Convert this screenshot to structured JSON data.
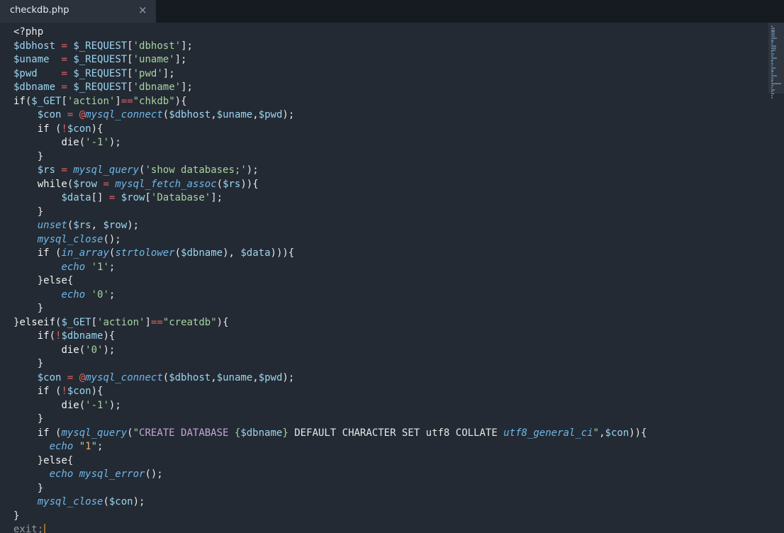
{
  "tab": {
    "title": "checkdb.php",
    "close_glyph": "×",
    "close_icon": "close-icon"
  },
  "colors": {
    "variable": "#9cd5f0",
    "operator": "#e5605f",
    "string": "#a8d3a0",
    "function": "#6fb7e9",
    "number": "#f2b36a",
    "sql": "#c6a6d9",
    "caret": "#f5a623",
    "background": "#232a33"
  },
  "code": {
    "lines": [
      [
        [
          "plain",
          "<?php"
        ]
      ],
      [
        [
          "var",
          "$dbhost"
        ],
        [
          "plain",
          " "
        ],
        [
          "op",
          "="
        ],
        [
          "plain",
          " "
        ],
        [
          "var",
          "$_REQUEST"
        ],
        [
          "plain",
          "["
        ],
        [
          "str",
          "'dbhost'"
        ],
        [
          "plain",
          "];"
        ]
      ],
      [
        [
          "var",
          "$uname"
        ],
        [
          "plain",
          "  "
        ],
        [
          "op",
          "="
        ],
        [
          "plain",
          " "
        ],
        [
          "var",
          "$_REQUEST"
        ],
        [
          "plain",
          "["
        ],
        [
          "str",
          "'uname'"
        ],
        [
          "plain",
          "];"
        ]
      ],
      [
        [
          "var",
          "$pwd"
        ],
        [
          "plain",
          "    "
        ],
        [
          "op",
          "="
        ],
        [
          "plain",
          " "
        ],
        [
          "var",
          "$_REQUEST"
        ],
        [
          "plain",
          "["
        ],
        [
          "str",
          "'pwd'"
        ],
        [
          "plain",
          "];"
        ]
      ],
      [
        [
          "var",
          "$dbname"
        ],
        [
          "plain",
          " "
        ],
        [
          "op",
          "="
        ],
        [
          "plain",
          " "
        ],
        [
          "var",
          "$_REQUEST"
        ],
        [
          "plain",
          "["
        ],
        [
          "str",
          "'dbname'"
        ],
        [
          "plain",
          "];"
        ]
      ],
      [
        [
          "kw",
          "if"
        ],
        [
          "plain",
          "("
        ],
        [
          "var",
          "$_GET"
        ],
        [
          "plain",
          "["
        ],
        [
          "str",
          "'action'"
        ],
        [
          "plain",
          "]"
        ],
        [
          "op",
          "=="
        ],
        [
          "str",
          "\"chkdb\""
        ],
        [
          "plain",
          "){"
        ]
      ],
      [
        [
          "plain",
          "    "
        ],
        [
          "var",
          "$con"
        ],
        [
          "plain",
          " "
        ],
        [
          "op",
          "="
        ],
        [
          "plain",
          " "
        ],
        [
          "at",
          "@"
        ],
        [
          "fn",
          "mysql_connect"
        ],
        [
          "plain",
          "("
        ],
        [
          "var",
          "$dbhost"
        ],
        [
          "plain",
          ","
        ],
        [
          "var",
          "$uname"
        ],
        [
          "plain",
          ","
        ],
        [
          "var",
          "$pwd"
        ],
        [
          "plain",
          ");"
        ]
      ],
      [
        [
          "plain",
          "    "
        ],
        [
          "kw",
          "if"
        ],
        [
          "plain",
          " ("
        ],
        [
          "op",
          "!"
        ],
        [
          "var",
          "$con"
        ],
        [
          "plain",
          "){"
        ]
      ],
      [
        [
          "plain",
          "        "
        ],
        [
          "kw",
          "die"
        ],
        [
          "plain",
          "("
        ],
        [
          "str",
          "'-1'"
        ],
        [
          "plain",
          ");"
        ]
      ],
      [
        [
          "plain",
          "    }"
        ]
      ],
      [
        [
          "plain",
          "    "
        ],
        [
          "var",
          "$rs"
        ],
        [
          "plain",
          " "
        ],
        [
          "op",
          "="
        ],
        [
          "plain",
          " "
        ],
        [
          "fn",
          "mysql_query"
        ],
        [
          "plain",
          "("
        ],
        [
          "str",
          "'show databases;'"
        ],
        [
          "plain",
          ");"
        ]
      ],
      [
        [
          "plain",
          "    "
        ],
        [
          "kw",
          "while"
        ],
        [
          "plain",
          "("
        ],
        [
          "var",
          "$row"
        ],
        [
          "plain",
          " "
        ],
        [
          "op",
          "="
        ],
        [
          "plain",
          " "
        ],
        [
          "fn",
          "mysql_fetch_assoc"
        ],
        [
          "plain",
          "("
        ],
        [
          "var",
          "$rs"
        ],
        [
          "plain",
          ")){"
        ]
      ],
      [
        [
          "plain",
          "        "
        ],
        [
          "var",
          "$data"
        ],
        [
          "plain",
          "[] "
        ],
        [
          "op",
          "="
        ],
        [
          "plain",
          " "
        ],
        [
          "var",
          "$row"
        ],
        [
          "plain",
          "["
        ],
        [
          "str",
          "'Database'"
        ],
        [
          "plain",
          "];"
        ]
      ],
      [
        [
          "plain",
          "    }"
        ]
      ],
      [
        [
          "plain",
          "    "
        ],
        [
          "fn",
          "unset"
        ],
        [
          "plain",
          "("
        ],
        [
          "var",
          "$rs"
        ],
        [
          "plain",
          ", "
        ],
        [
          "var",
          "$row"
        ],
        [
          "plain",
          ");"
        ]
      ],
      [
        [
          "plain",
          "    "
        ],
        [
          "fn",
          "mysql_close"
        ],
        [
          "plain",
          "();"
        ]
      ],
      [
        [
          "plain",
          "    "
        ],
        [
          "kw",
          "if"
        ],
        [
          "plain",
          " ("
        ],
        [
          "fn",
          "in_array"
        ],
        [
          "plain",
          "("
        ],
        [
          "fn",
          "strtolower"
        ],
        [
          "plain",
          "("
        ],
        [
          "var",
          "$dbname"
        ],
        [
          "plain",
          "), "
        ],
        [
          "var",
          "$data"
        ],
        [
          "plain",
          "))){"
        ]
      ],
      [
        [
          "plain",
          "        "
        ],
        [
          "fn",
          "echo"
        ],
        [
          "plain",
          " "
        ],
        [
          "str",
          "'1'"
        ],
        [
          "plain",
          ";"
        ]
      ],
      [
        [
          "plain",
          "    }"
        ],
        [
          "kw",
          "else"
        ],
        [
          "plain",
          "{"
        ]
      ],
      [
        [
          "plain",
          "        "
        ],
        [
          "fn",
          "echo"
        ],
        [
          "plain",
          " "
        ],
        [
          "str",
          "'0'"
        ],
        [
          "plain",
          ";"
        ]
      ],
      [
        [
          "plain",
          "    }"
        ]
      ],
      [
        [
          "plain",
          "}"
        ],
        [
          "kw",
          "elseif"
        ],
        [
          "plain",
          "("
        ],
        [
          "var",
          "$_GET"
        ],
        [
          "plain",
          "["
        ],
        [
          "str",
          "'action'"
        ],
        [
          "plain",
          "]"
        ],
        [
          "op",
          "=="
        ],
        [
          "str",
          "\"creatdb\""
        ],
        [
          "plain",
          "){"
        ]
      ],
      [
        [
          "plain",
          "    "
        ],
        [
          "kw",
          "if"
        ],
        [
          "plain",
          "("
        ],
        [
          "op",
          "!"
        ],
        [
          "var",
          "$dbname"
        ],
        [
          "plain",
          "){"
        ]
      ],
      [
        [
          "plain",
          "        "
        ],
        [
          "kw",
          "die"
        ],
        [
          "plain",
          "("
        ],
        [
          "str",
          "'0'"
        ],
        [
          "plain",
          ");"
        ]
      ],
      [
        [
          "plain",
          "    }"
        ]
      ],
      [
        [
          "plain",
          "    "
        ],
        [
          "var",
          "$con"
        ],
        [
          "plain",
          " "
        ],
        [
          "op",
          "="
        ],
        [
          "plain",
          " "
        ],
        [
          "at",
          "@"
        ],
        [
          "fn",
          "mysql_connect"
        ],
        [
          "plain",
          "("
        ],
        [
          "var",
          "$dbhost"
        ],
        [
          "plain",
          ","
        ],
        [
          "var",
          "$uname"
        ],
        [
          "plain",
          ","
        ],
        [
          "var",
          "$pwd"
        ],
        [
          "plain",
          ");"
        ]
      ],
      [
        [
          "plain",
          "    "
        ],
        [
          "kw",
          "if"
        ],
        [
          "plain",
          " ("
        ],
        [
          "op",
          "!"
        ],
        [
          "var",
          "$con"
        ],
        [
          "plain",
          "){"
        ]
      ],
      [
        [
          "plain",
          "        "
        ],
        [
          "kw",
          "die"
        ],
        [
          "plain",
          "("
        ],
        [
          "str",
          "'-1'"
        ],
        [
          "plain",
          ");"
        ]
      ],
      [
        [
          "plain",
          "    }"
        ]
      ],
      [
        [
          "plain",
          "    "
        ],
        [
          "kw",
          "if"
        ],
        [
          "plain",
          " ("
        ],
        [
          "fn",
          "mysql_query"
        ],
        [
          "plain",
          "("
        ],
        [
          "str",
          "\""
        ],
        [
          "sql",
          "CREATE DATABASE "
        ],
        [
          "str",
          "{"
        ],
        [
          "var",
          "$dbname"
        ],
        [
          "str",
          "}"
        ],
        [
          "plain",
          " DEFAULT CHARACTER SET utf8 COLLATE "
        ],
        [
          "fn",
          "utf8_general_ci"
        ],
        [
          "str",
          "\""
        ],
        [
          "plain",
          ","
        ],
        [
          "var",
          "$con"
        ],
        [
          "plain",
          ")){"
        ]
      ],
      [
        [
          "plain",
          "      "
        ],
        [
          "fn",
          "echo"
        ],
        [
          "plain",
          " "
        ],
        [
          "str",
          "\""
        ],
        [
          "num",
          "1"
        ],
        [
          "str",
          "\""
        ],
        [
          "plain",
          ";"
        ]
      ],
      [
        [
          "plain",
          "    }"
        ],
        [
          "kw",
          "else"
        ],
        [
          "plain",
          "{"
        ]
      ],
      [
        [
          "plain",
          "      "
        ],
        [
          "fn",
          "echo"
        ],
        [
          "plain",
          " "
        ],
        [
          "fn",
          "mysql_error"
        ],
        [
          "plain",
          "();"
        ]
      ],
      [
        [
          "plain",
          "    }"
        ]
      ],
      [
        [
          "plain",
          "    "
        ],
        [
          "fn",
          "mysql_close"
        ],
        [
          "plain",
          "("
        ],
        [
          "var",
          "$con"
        ],
        [
          "plain",
          ");"
        ]
      ],
      [
        [
          "plain",
          "}"
        ]
      ],
      [
        [
          "kw",
          "exit"
        ],
        [
          "plain",
          ";"
        ]
      ]
    ]
  }
}
